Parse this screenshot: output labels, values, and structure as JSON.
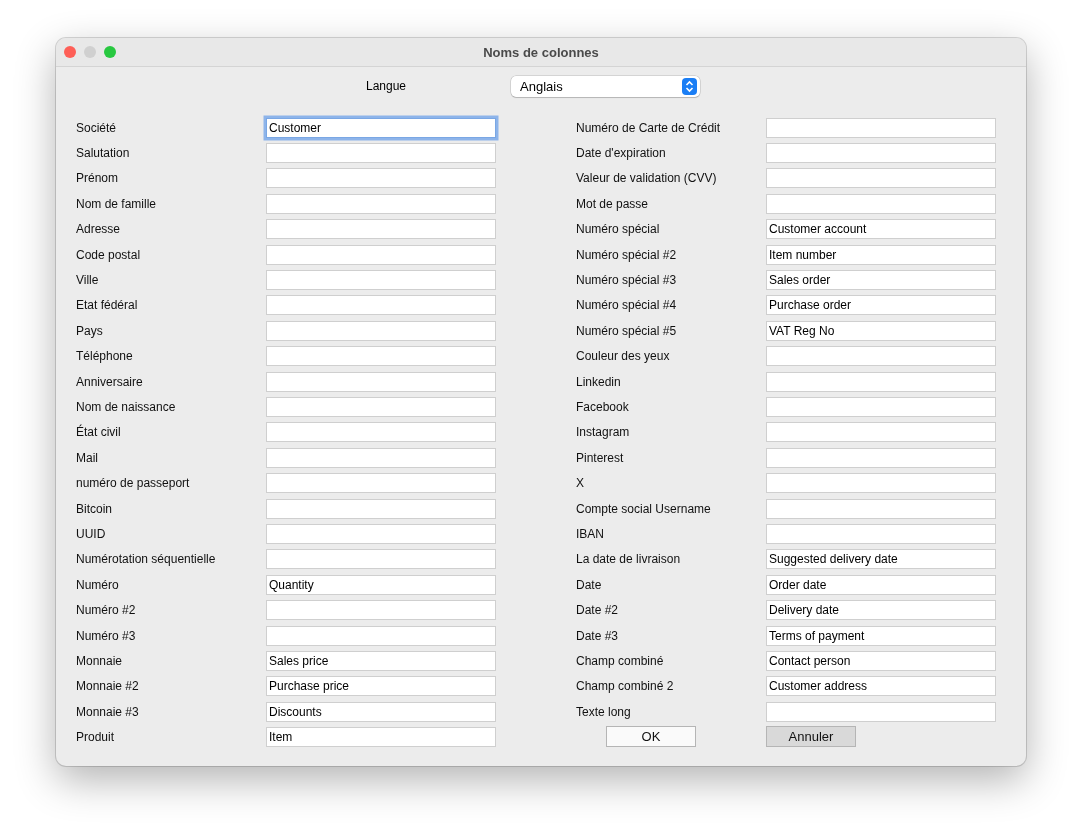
{
  "window": {
    "title": "Noms de colonnes"
  },
  "language": {
    "label": "Langue",
    "value": "Anglais"
  },
  "left_fields": [
    {
      "label": "Société",
      "value": "Customer",
      "focused": true
    },
    {
      "label": "Salutation",
      "focused": false
    },
    {
      "label": "Prénom",
      "focused": false
    },
    {
      "label": "Nom de famille",
      "focused": false
    },
    {
      "label": "Adresse",
      "focused": false
    },
    {
      "label": "Code postal",
      "focused": false
    },
    {
      "label": "Ville",
      "focused": false
    },
    {
      "label": "Etat fédéral",
      "focused": false
    },
    {
      "label": "Pays",
      "focused": false
    },
    {
      "label": "Téléphone",
      "focused": false
    },
    {
      "label": "Anniversaire",
      "focused": false
    },
    {
      "label": "Nom de naissance",
      "focused": false
    },
    {
      "label": "État civil",
      "focused": false
    },
    {
      "label": "Mail",
      "focused": false
    },
    {
      "label": "numéro de passeport",
      "focused": false
    },
    {
      "label": "Bitcoin",
      "focused": false
    },
    {
      "label": "UUID",
      "focused": false
    },
    {
      "label": "Numérotation séquentielle",
      "focused": false
    },
    {
      "label": "Numéro",
      "value": "Quantity",
      "focused": false
    },
    {
      "label": "Numéro #2",
      "focused": false
    },
    {
      "label": "Numéro #3",
      "focused": false
    },
    {
      "label": "Monnaie",
      "value": "Sales price",
      "focused": false
    },
    {
      "label": "Monnaie #2",
      "value": "Purchase price",
      "focused": false
    },
    {
      "label": "Monnaie #3",
      "value": "Discounts",
      "focused": false
    },
    {
      "label": "Produit",
      "value": "Item",
      "focused": false
    }
  ],
  "right_fields": [
    {
      "label": "Numéro de Carte de Crédit",
      "focused": false
    },
    {
      "label": "Date d'expiration",
      "focused": false
    },
    {
      "label": "Valeur de validation (CVV)",
      "focused": false
    },
    {
      "label": "Mot de passe",
      "focused": false
    },
    {
      "label": "Numéro spécial",
      "value": "Customer account",
      "focused": false
    },
    {
      "label": "Numéro spécial #2",
      "value": "Item number",
      "focused": false
    },
    {
      "label": "Numéro spécial #3",
      "value": "Sales order",
      "focused": false
    },
    {
      "label": "Numéro spécial #4",
      "value": "Purchase order",
      "focused": false
    },
    {
      "label": "Numéro spécial #5",
      "value": "VAT Reg No",
      "focused": false
    },
    {
      "label": "Couleur des yeux",
      "focused": false
    },
    {
      "label": "Linkedin",
      "focused": false
    },
    {
      "label": "Facebook",
      "focused": false
    },
    {
      "label": "Instagram",
      "focused": false
    },
    {
      "label": "Pinterest",
      "focused": false
    },
    {
      "label": "X",
      "focused": false
    },
    {
      "label": "Compte social Username",
      "focused": false
    },
    {
      "label": "IBAN",
      "focused": false
    },
    {
      "label": "La date de livraison",
      "value": "Suggested delivery date",
      "focused": false
    },
    {
      "label": "Date",
      "value": "Order date",
      "focused": false
    },
    {
      "label": "Date #2",
      "value": "Delivery date",
      "focused": false
    },
    {
      "label": "Date #3",
      "value": "Terms of payment",
      "focused": false
    },
    {
      "label": "Champ combiné",
      "value": "Contact person",
      "focused": false
    },
    {
      "label": "Champ combiné 2",
      "value": "Customer address",
      "focused": false
    },
    {
      "label": "Texte long",
      "focused": false
    }
  ],
  "buttons": [
    {
      "label": "OK",
      "pressed": false
    },
    {
      "label": "Annuler",
      "pressed": true
    }
  ]
}
